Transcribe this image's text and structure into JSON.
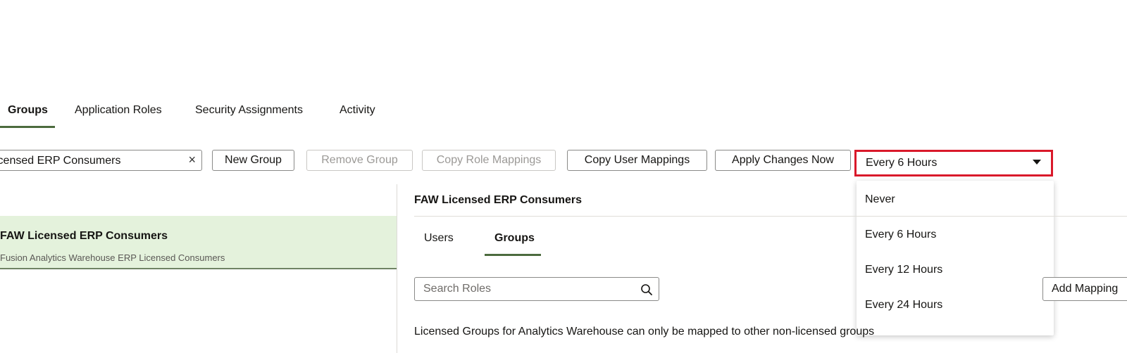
{
  "tabs": [
    {
      "label": "Groups",
      "active": true
    },
    {
      "label": "Application Roles",
      "active": false
    },
    {
      "label": "Security Assignments",
      "active": false
    },
    {
      "label": "Activity",
      "active": false
    }
  ],
  "toolbar": {
    "group_search_value": "icensed ERP Consumers",
    "new_group": "New Group",
    "remove_group": "Remove Group",
    "copy_role_mappings": "Copy Role Mappings",
    "copy_user_mappings": "Copy User Mappings",
    "apply_changes_now": "Apply Changes Now",
    "frequency_selected": "Every 6 Hours"
  },
  "frequency_options": [
    "Never",
    "Every 6 Hours",
    "Every 12 Hours",
    "Every 24 Hours"
  ],
  "group_list": [
    {
      "name": "FAW Licensed ERP Consumers",
      "description": "Fusion Analytics Warehouse ERP Licensed Consumers"
    }
  ],
  "detail": {
    "title": "FAW Licensed ERP Consumers",
    "subtabs": [
      {
        "label": "Users",
        "active": false
      },
      {
        "label": "Groups",
        "active": true
      }
    ],
    "search_placeholder": "Search Roles",
    "add_mapping": "Add Mapping",
    "note": "Licensed Groups for Analytics Warehouse can only be mapped to other non-licensed groups"
  },
  "colors": {
    "accent_underline": "#4c6b3e",
    "highlight_border": "#d9192a",
    "selected_row": "#e4f2dc"
  }
}
